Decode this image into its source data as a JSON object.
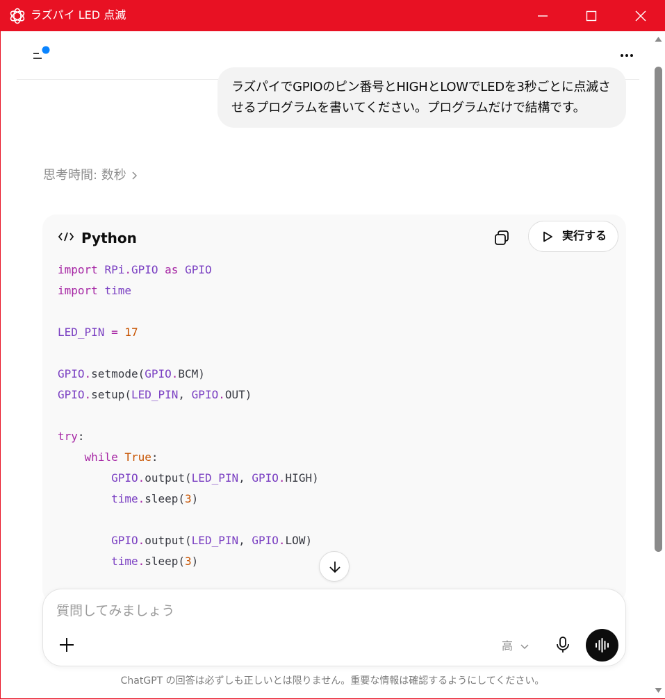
{
  "window": {
    "title": "ラズパイ LED 点滅",
    "accent_color": "#e81123"
  },
  "header": {
    "sidebar_icon": "sidebar-toggle-icon",
    "more_icon": "more-dots-icon",
    "notification_dot_color": "#0a84ff"
  },
  "user_message": {
    "line1": "ラズパイでGPIOのピン番号とHIGHとLOWでLEDを3秒ごとに点滅さ",
    "line2": "せるプログラムを書いてください。プログラムだけで結構です。"
  },
  "thinking": {
    "label": "思考時間: 数秒"
  },
  "code_block": {
    "language": "Python",
    "run_label": "実行する",
    "lines": [
      "import RPi.GPIO as GPIO",
      "import time",
      "",
      "LED_PIN = 17",
      "",
      "GPIO.setmode(GPIO.BCM)",
      "GPIO.setup(LED_PIN, GPIO.OUT)",
      "",
      "try:",
      "    while True:",
      "        GPIO.output(LED_PIN, GPIO.HIGH)",
      "        time.sleep(3)",
      "",
      "        GPIO.output(LED_PIN, GPIO.LOW)",
      "        time.sleep(3)"
    ]
  },
  "composer": {
    "placeholder": "質問してみましょう",
    "model_label": "高"
  },
  "footer": {
    "disclaimer": "ChatGPT の回答は必ずしも正しいとは限りません。重要な情報は確認するようにしてください。"
  }
}
